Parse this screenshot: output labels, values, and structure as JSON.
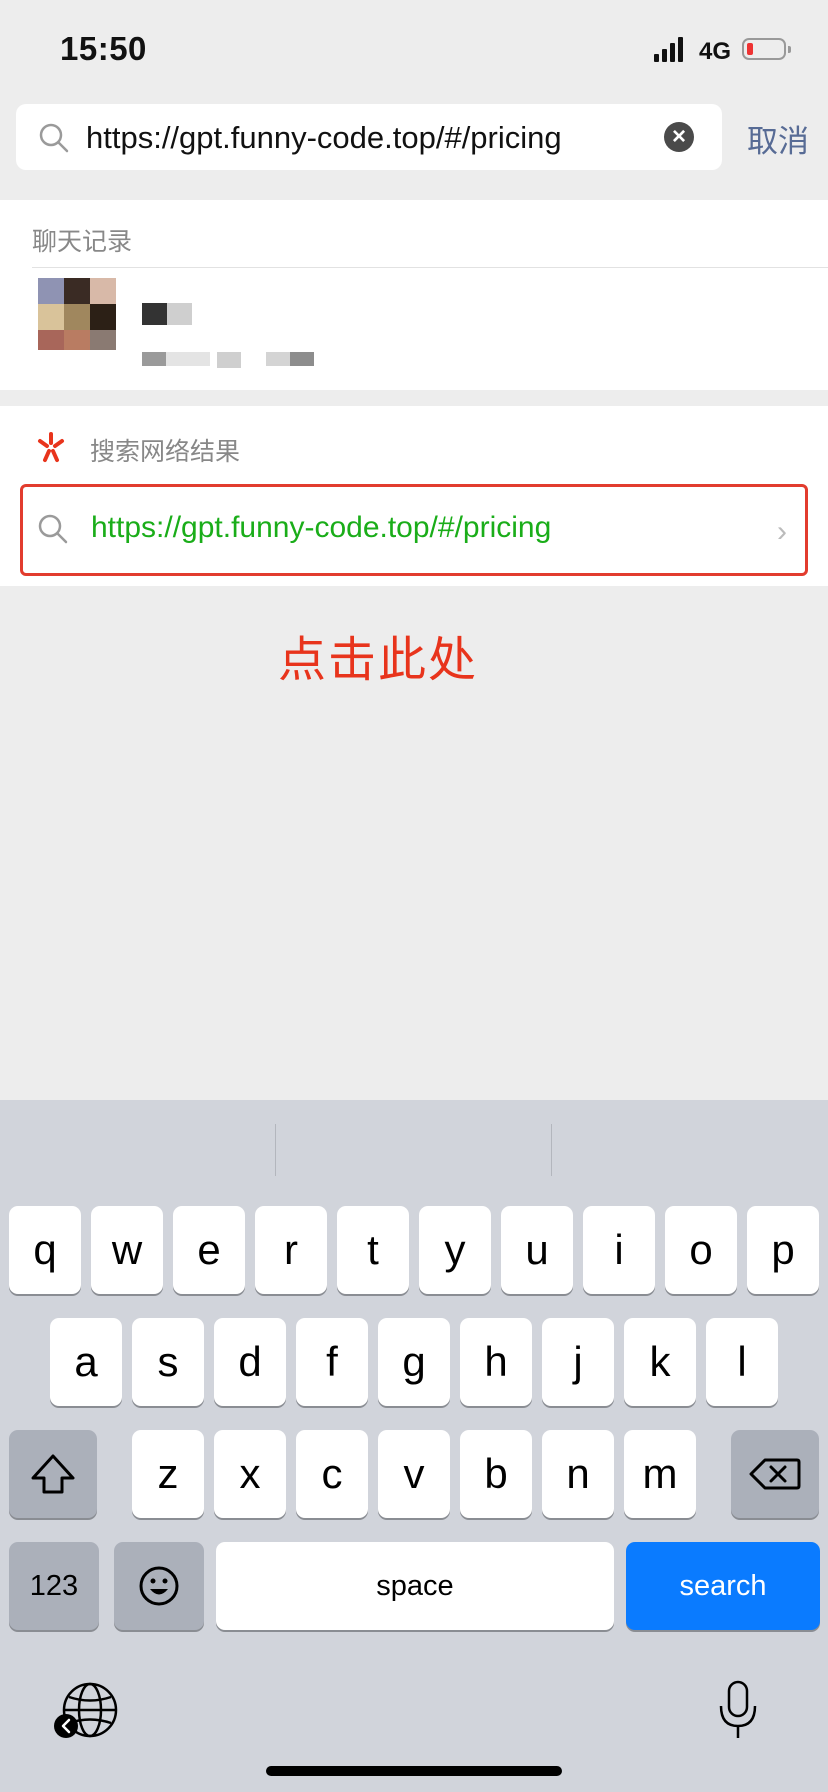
{
  "status_bar": {
    "time": "15:50",
    "network": "4G"
  },
  "search": {
    "query": "https://gpt.funny-code.top/#/pricing",
    "cancel_label": "取消"
  },
  "chat_history": {
    "title": "聊天记录"
  },
  "web_search": {
    "title": "搜索网络结果",
    "result_text": "https://gpt.funny-code.top/#/pricing"
  },
  "annotation": "点击此处",
  "keyboard": {
    "row1": [
      "q",
      "w",
      "e",
      "r",
      "t",
      "y",
      "u",
      "i",
      "o",
      "p"
    ],
    "row2": [
      "a",
      "s",
      "d",
      "f",
      "g",
      "h",
      "j",
      "k",
      "l"
    ],
    "row3": [
      "z",
      "x",
      "c",
      "v",
      "b",
      "n",
      "m"
    ],
    "numbers_label": "123",
    "space_label": "space",
    "search_label": "search"
  },
  "colors": {
    "accent_green": "#1aad19",
    "highlight_red": "#e23c2e",
    "annotation_red": "#e8341c",
    "key_blue": "#0a7bff",
    "cancel_blue": "#576b95"
  }
}
